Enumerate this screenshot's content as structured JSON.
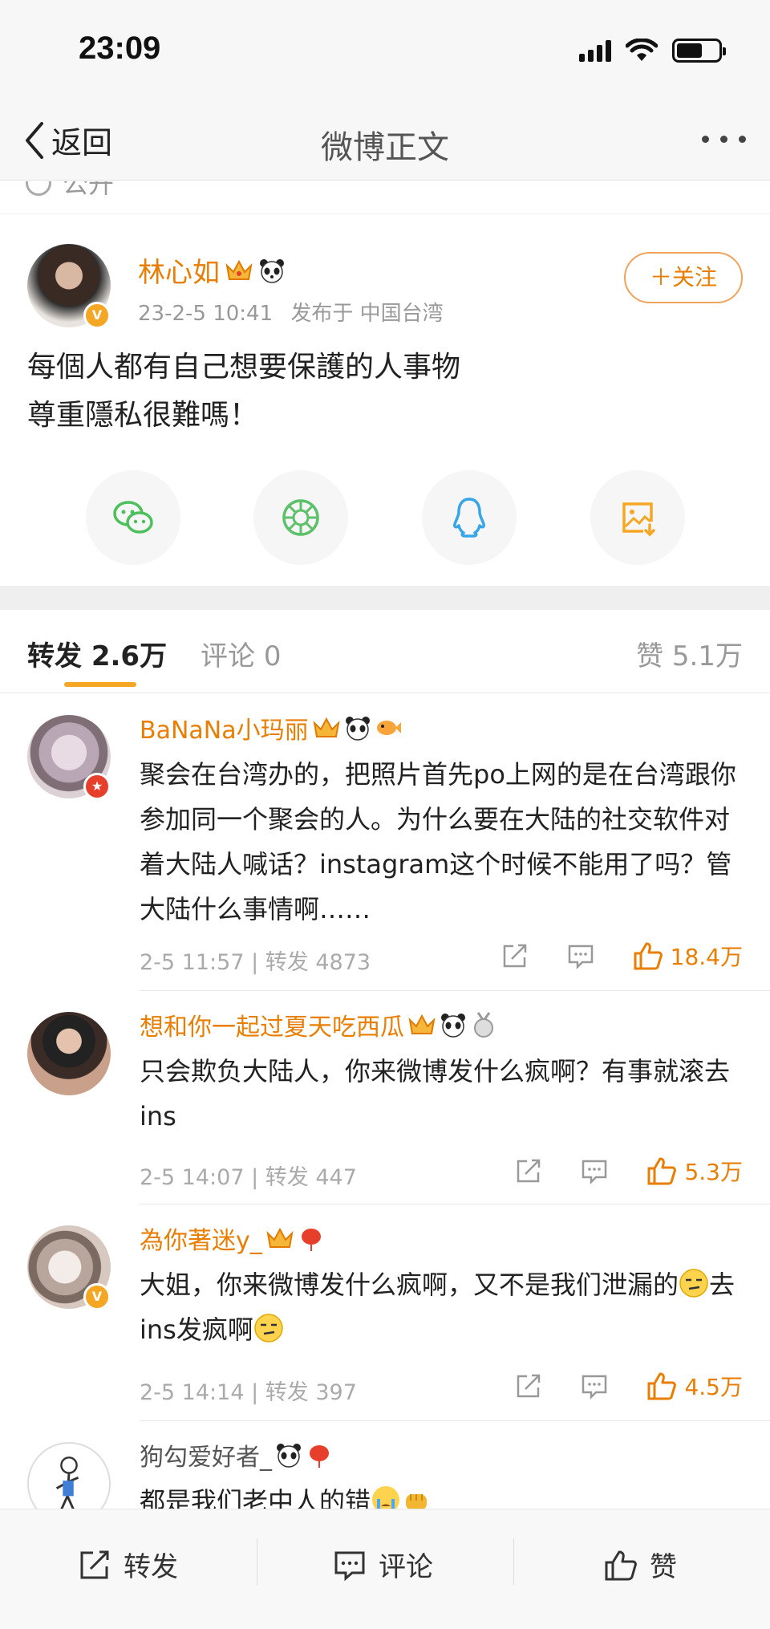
{
  "status_bar": {
    "time": "23:09"
  },
  "nav": {
    "back_label": "返回",
    "title": "微博正文"
  },
  "partial_visibility": "公开",
  "post": {
    "author": "林心如",
    "meta_time": "23-2-5 10:41",
    "meta_source": "发布于 中国台湾",
    "follow_label": "＋关注",
    "text_line1": "每個人都有自己想要保護的人事物",
    "text_line2": "尊重隱私很難嗎！",
    "share_icons": [
      "wechat-icon",
      "moments-icon",
      "qq-icon",
      "save-image-icon"
    ]
  },
  "tabs": {
    "repost_label": "转发",
    "repost_count": "2.6万",
    "comment_label": "评论",
    "comment_count": "0",
    "like_label": "赞",
    "like_count": "5.1万"
  },
  "reposts": [
    {
      "name": "BaNaNa小玛丽",
      "text": "聚会在台湾办的，把照片首先po上网的是在台湾跟你参加同一个聚会的人。为什么要在大陆的社交软件对着大陆人喊话？instagram这个时候不能用了吗？管大陆什么事情啊……",
      "time": "2-5 11:57",
      "repost_label": "转发",
      "repost_count": "4873",
      "likes": "18.4万"
    },
    {
      "name": "想和你一起过夏天吃西瓜",
      "text": "只会欺负大陆人，你来微博发什么疯啊？有事就滚去ins",
      "time": "2-5 14:07",
      "repost_label": "转发",
      "repost_count": "447",
      "likes": "5.3万"
    },
    {
      "name": "為你著迷y_",
      "text_a": "大姐，你来微博发什么疯啊，又不是我们泄漏的",
      "text_b": "去ins发疯啊",
      "time": "2-5 14:14",
      "repost_label": "转发",
      "repost_count": "397",
      "likes": "4.5万"
    },
    {
      "name": "狗勾爱好者_",
      "text": "都是我们老中人的错"
    }
  ],
  "bottom_bar": {
    "repost_label": "转发",
    "comment_label": "评论",
    "like_label": "赞"
  },
  "colors": {
    "accent": "#e87e04",
    "link_orange": "#f5a623"
  }
}
